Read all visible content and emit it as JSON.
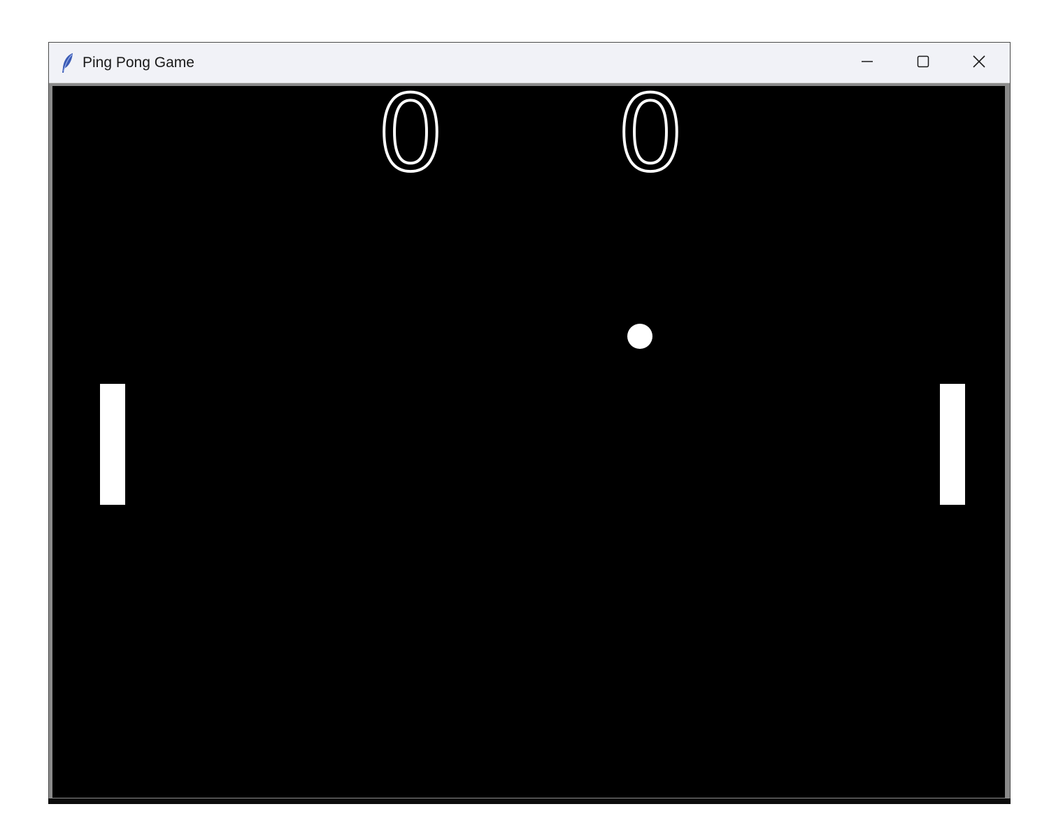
{
  "window": {
    "title": "Ping Pong Game",
    "app_icon": "feather-icon",
    "controls": {
      "minimize": "minimize-icon",
      "maximize": "maximize-icon",
      "close": "close-icon"
    }
  },
  "game": {
    "background_color": "#000000",
    "foreground_color": "#ffffff",
    "score_left": "0",
    "score_right": "0"
  }
}
